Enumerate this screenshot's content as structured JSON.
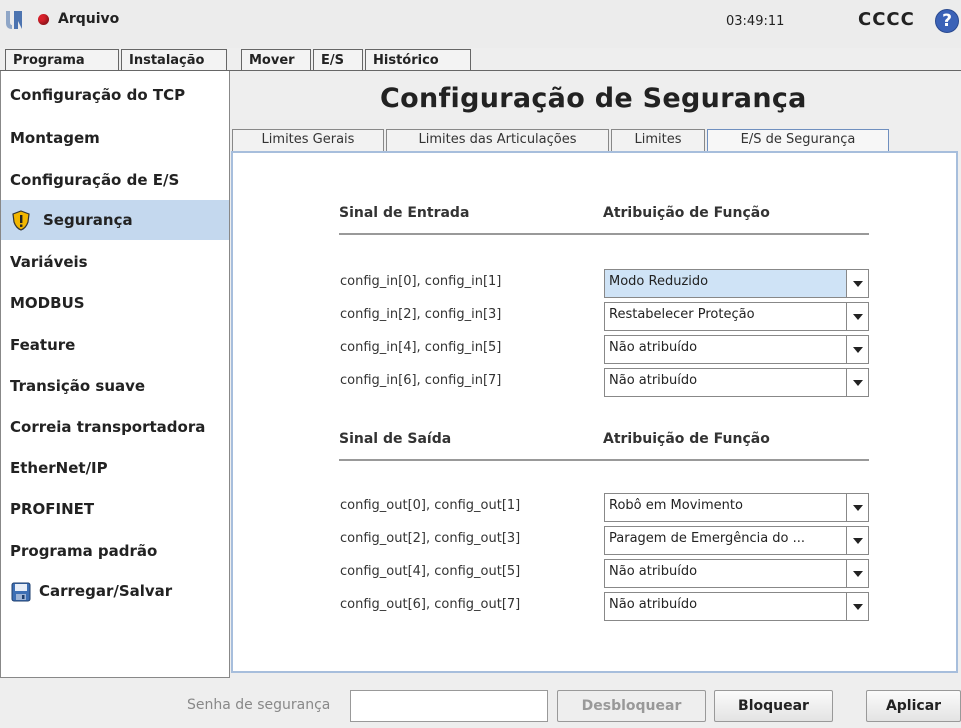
{
  "header": {
    "menu_label": "Arquivo",
    "clock": "03:49:11",
    "robot_name": "CCCC",
    "help_glyph": "?"
  },
  "main_tabs": [
    {
      "label": "Programa"
    },
    {
      "label": "Instalação"
    },
    {
      "label": "Mover"
    },
    {
      "label": "E/S"
    },
    {
      "label": "Histórico"
    }
  ],
  "sidebar": {
    "items": [
      {
        "label": "Configuração do TCP"
      },
      {
        "label": "Montagem"
      },
      {
        "label": "Configuração de E/S"
      },
      {
        "label": "Segurança",
        "icon": "warning-shield-icon",
        "active": true
      },
      {
        "label": "Variáveis"
      },
      {
        "label": "MODBUS"
      },
      {
        "label": "Feature"
      },
      {
        "label": "Transição suave"
      },
      {
        "label": "Correia transportadora"
      },
      {
        "label": "EtherNet/IP"
      },
      {
        "label": "PROFINET"
      },
      {
        "label": "Programa padrão"
      },
      {
        "label": "Carregar/Salvar",
        "icon": "floppy-disk-icon"
      }
    ]
  },
  "page": {
    "title": "Configuração de Segurança",
    "sub_tabs": [
      {
        "label": "Limites Gerais"
      },
      {
        "label": "Limites das Articulações"
      },
      {
        "label": "Limites"
      },
      {
        "label": "E/S de Segurança",
        "active": true
      }
    ]
  },
  "inputs": {
    "signal_header": "Sinal de Entrada",
    "function_header": "Atribuição de Função",
    "rows": [
      {
        "signal": "config_in[0], config_in[1]",
        "value": "Modo Reduzido"
      },
      {
        "signal": "config_in[2], config_in[3]",
        "value": "Restabelecer Proteção"
      },
      {
        "signal": "config_in[4], config_in[5]",
        "value": "Não atribuído"
      },
      {
        "signal": "config_in[6], config_in[7]",
        "value": "Não atribuído"
      }
    ]
  },
  "outputs": {
    "signal_header": "Sinal de Saída",
    "function_header": "Atribuição de Função",
    "rows": [
      {
        "signal": "config_out[0], config_out[1]",
        "value": "Robô em Movimento"
      },
      {
        "signal": "config_out[2], config_out[3]",
        "value": "Paragem de Emergência do ..."
      },
      {
        "signal": "config_out[4], config_out[5]",
        "value": "Não atribuído"
      },
      {
        "signal": "config_out[6], config_out[7]",
        "value": "Não atribuído"
      }
    ]
  },
  "footer": {
    "password_label": "Senha de segurança",
    "password_value": "",
    "unlock_label": "Desbloquear",
    "lock_label": "Bloquear",
    "apply_label": "Aplicar"
  },
  "colors": {
    "selection": "#c4d8ee",
    "panel_border": "#a7bedc",
    "record_dot": "#d8202a",
    "help": "#3b62b7"
  }
}
